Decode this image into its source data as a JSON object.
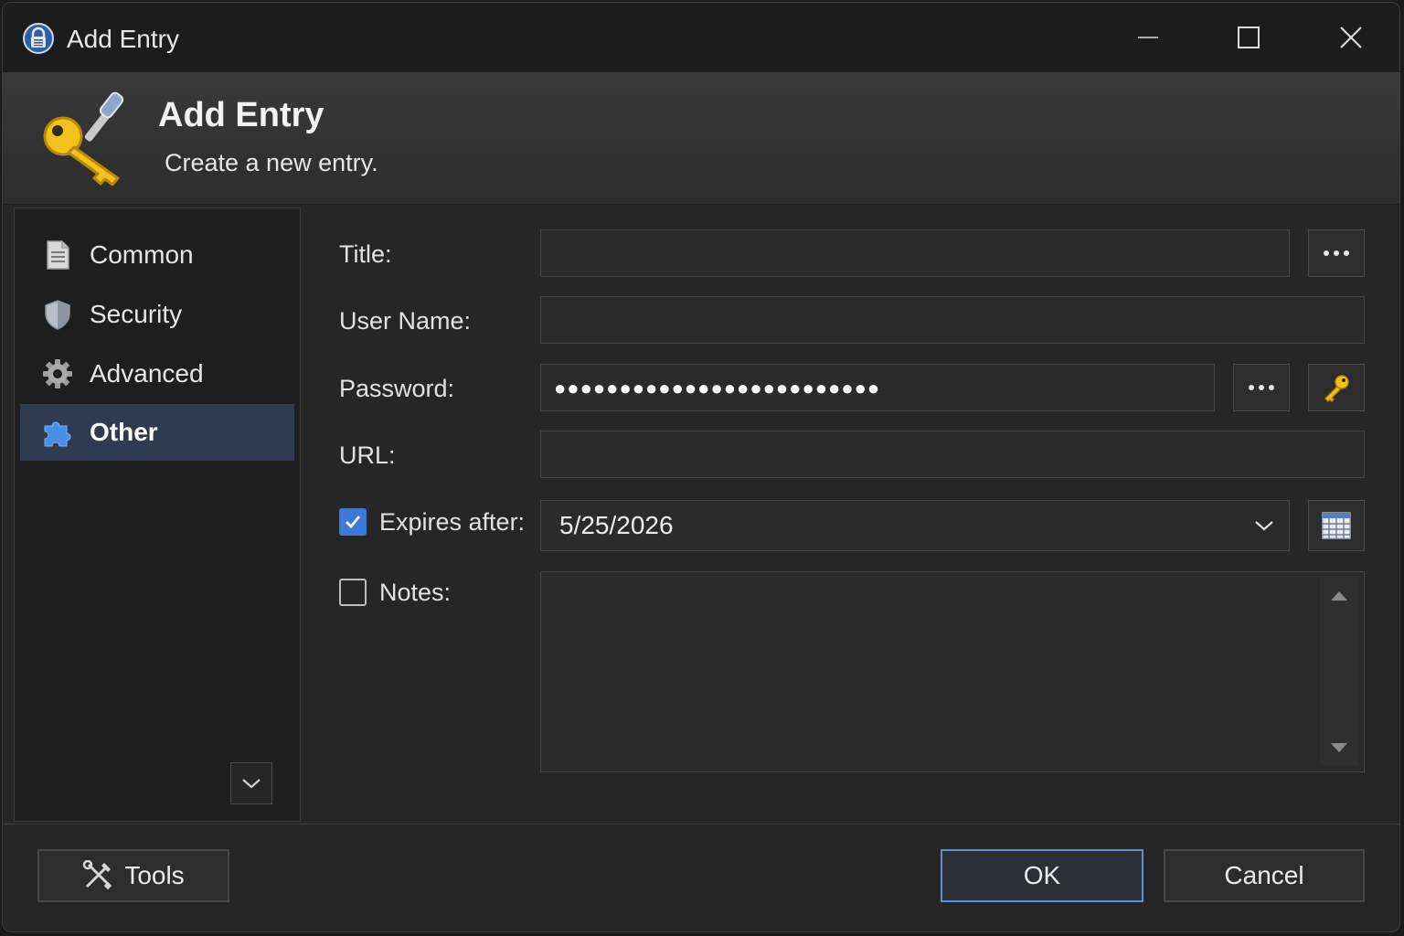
{
  "window": {
    "title": "Add Entry",
    "controls": {
      "minimize": "minimize-icon",
      "maximize": "maximize-icon",
      "close": "close-icon"
    }
  },
  "header": {
    "title": "Add Entry",
    "subtitle": "Create a new entry.",
    "icon": "key-icon"
  },
  "sidebar": {
    "items": [
      {
        "label": "Common",
        "icon": "document-icon",
        "active": false
      },
      {
        "label": "Security",
        "icon": "shield-icon",
        "active": false
      },
      {
        "label": "Advanced",
        "icon": "gear-icon",
        "active": false
      },
      {
        "label": "Other",
        "icon": "puzzle-icon",
        "active": true
      }
    ],
    "scroll_icon": "chevron-down-icon"
  },
  "form": {
    "title_label": "Title:",
    "title_value": "",
    "username_label": "User Name:",
    "username_value": "",
    "password_label": "Password:",
    "password_mask": "●●●●●●●●●●●●●●●●●●●●●●●●●",
    "url_label": "URL:",
    "url_value": "",
    "expires_label": "Expires after:",
    "expires_checked": true,
    "expires_value": "5/25/2026",
    "notes_label": "Notes:",
    "notes_checked": false,
    "notes_value": ""
  },
  "footer": {
    "tools_label": "Tools",
    "ok_label": "OK",
    "cancel_label": "Cancel"
  },
  "colors": {
    "accent": "#3d7ad6",
    "ok_border": "#5f8fd1",
    "sidebar_active": "#2f3b50",
    "key_gold": "#f2c21b"
  }
}
